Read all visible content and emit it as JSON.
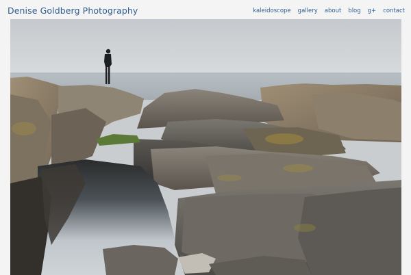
{
  "site": {
    "title": "Denise Goldberg Photography"
  },
  "nav": {
    "items": [
      {
        "label": "kaleidoscope"
      },
      {
        "label": "gallery"
      },
      {
        "label": "about"
      },
      {
        "label": "blog"
      },
      {
        "label": "g+"
      },
      {
        "label": "contact"
      }
    ]
  },
  "colors": {
    "link": "#2d5d8f",
    "background": "#f4f4f4"
  }
}
